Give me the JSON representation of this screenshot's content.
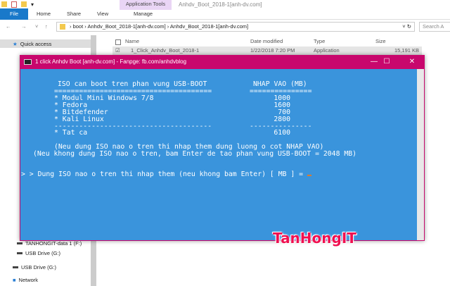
{
  "explorer": {
    "title": "Anhdv_Boot_2018-1[anh-dv.com]",
    "context_tab": "Application Tools",
    "tabs": [
      "File",
      "Home",
      "Share",
      "View",
      "Manage"
    ],
    "breadcrumb": [
      "boot",
      "Anhdv_Boot_2018-1[anh-dv.com]",
      "Anhdv_Boot_2018-1[anh-dv.com]"
    ],
    "search_placeholder": "Search A",
    "columns": [
      "Name",
      "Date modified",
      "Type",
      "Size"
    ],
    "files": [
      {
        "name": "1_Click_Anhdv_Boot_2018-1",
        "date": "1/22/2018 7:20 PM",
        "type": "Application",
        "size": "15,191 KB"
      }
    ],
    "sidebar": [
      "Quick access",
      "TANHONGIT-data 1 (F:)",
      "USB Drive (G:)",
      "USB Drive (G:)",
      "Network"
    ]
  },
  "console": {
    "title": "1 click Anhdv Boot [anh-dv.com] -  Fanpge: fb.com/anhdvblog",
    "header_left": "ISO can boot tren phan vung USB-BOOT",
    "header_right": "NHAP VAO (MB)",
    "sep_left": "======================================",
    "sep_right": "===============",
    "sep2_left": "--------------------------------------",
    "sep2_right": "---------------",
    "items": [
      {
        "name": "* Modul Mini Windows 7/8",
        "mb": "1000"
      },
      {
        "name": "* Fedora",
        "mb": "1600"
      },
      {
        "name": "* Bitdefender",
        "mb": "700"
      },
      {
        "name": "* Kali Linux",
        "mb": "2800"
      }
    ],
    "total": {
      "name": "* Tat ca",
      "mb": "6100"
    },
    "note1": "(Neu dung ISO nao o tren thi nhap them dung luong o cot NHAP VAO)",
    "note2": "(Neu khong dung ISO nao o tren, bam Enter de tao phan vung USB-BOOT = 2048 MB)",
    "prompt": "> > Dung ISO nao o tren thi nhap them (neu khong bam Enter) [ MB ] = "
  },
  "watermark": "TanHongIT",
  "colors": {
    "console_bg": "#3a94dc",
    "titlebar": "#c8076d",
    "watermark": "#f01050"
  }
}
